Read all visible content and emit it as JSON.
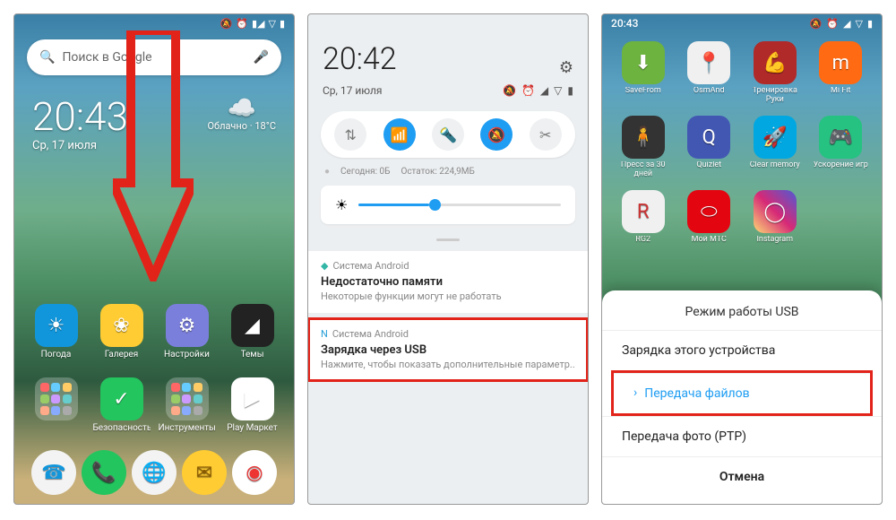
{
  "pane1": {
    "search_placeholder": "Поиск в Google",
    "clock": "20:43",
    "date": "Ср, 17 июля",
    "weather_label": "Облачно · 18°C",
    "row1": [
      {
        "label": "Погода",
        "bg": "#1296db",
        "glyph": "☀"
      },
      {
        "label": "Галерея",
        "bg": "#ffcc33",
        "glyph": "❀"
      },
      {
        "label": "Настройки",
        "bg": "#7b7fdc",
        "glyph": "⚙"
      },
      {
        "label": "Темы",
        "bg": "#222",
        "glyph": "◢"
      }
    ],
    "row2": [
      {
        "label": "",
        "type": "folder"
      },
      {
        "label": "Безопасность",
        "bg": "#23c55e",
        "glyph": "✓"
      },
      {
        "label": "Инструменты",
        "type": "folder2"
      },
      {
        "label": "Play Маркет",
        "bg": "#fff",
        "glyph": "▶"
      }
    ],
    "dock": [
      {
        "bg": "#f3f3f3",
        "glyph": "☎",
        "fg": "#1296db"
      },
      {
        "bg": "#23c55e",
        "glyph": "📞"
      },
      {
        "bg": "#f3f3f3",
        "glyph": "🌐",
        "fg": "#1296db"
      },
      {
        "bg": "#ffcc33",
        "glyph": "✉",
        "fg": "#8a5a00"
      },
      {
        "bg": "#fff",
        "glyph": "◉",
        "fg": "#e33"
      }
    ]
  },
  "pane2": {
    "time": "20:42",
    "date": "Ср, 17 июля",
    "usage_today": "Сегодня: 0Б",
    "usage_remain": "Остаток: 224,9МБ",
    "notifs": [
      {
        "app": "Система Android",
        "title": "Недостаточно памяти",
        "body": "Некоторые функции могут не работать",
        "hi": false,
        "icon": "◆",
        "iconColor": "#33b6a6"
      },
      {
        "app": "Система Android",
        "title": "Зарядка через USB",
        "body": "Нажмите, чтобы показать дополнительные параметр..",
        "hi": true,
        "icon": "N",
        "iconColor": "#29a0d8"
      }
    ]
  },
  "pane3": {
    "time": "20:43",
    "apps": [
      {
        "label": "SaveFrom",
        "bg": "#6db33f",
        "glyph": "⬇"
      },
      {
        "label": "OsmAnd",
        "bg": "#f0f0f0",
        "glyph": "📍",
        "fg": "#f80"
      },
      {
        "label": "Тренировка Руки",
        "bg": "#b02a2a",
        "glyph": "💪"
      },
      {
        "label": "Mi Fit",
        "bg": "#ff6a13",
        "glyph": "m"
      },
      {
        "label": "Пресс за 30 дней",
        "bg": "#333",
        "glyph": "🧍"
      },
      {
        "label": "Quizlet",
        "bg": "#4257b2",
        "glyph": "Q"
      },
      {
        "label": "Clear memory",
        "bg": "#00a7e1",
        "glyph": "🚀"
      },
      {
        "label": "Ускорение игр",
        "bg": "#26c281",
        "glyph": "🎮"
      },
      {
        "label": "RG2",
        "bg": "#f0f0f0",
        "glyph": "R",
        "fg": "#c33"
      },
      {
        "label": "Мой МТС",
        "bg": "#e30611",
        "glyph": "⬭"
      },
      {
        "label": "Instagram",
        "bg": "linear-gradient(45deg,#feda75,#d62976,#4f5bd5)",
        "glyph": "◯"
      }
    ],
    "sheet": {
      "title": "Режим работы USB",
      "items": [
        {
          "label": "Зарядка этого устройства",
          "hi": false
        },
        {
          "label": "Передача файлов",
          "hi": true,
          "accent": true
        },
        {
          "label": "Передача фото (PTP)",
          "hi": false
        }
      ],
      "cancel": "Отмена"
    }
  }
}
